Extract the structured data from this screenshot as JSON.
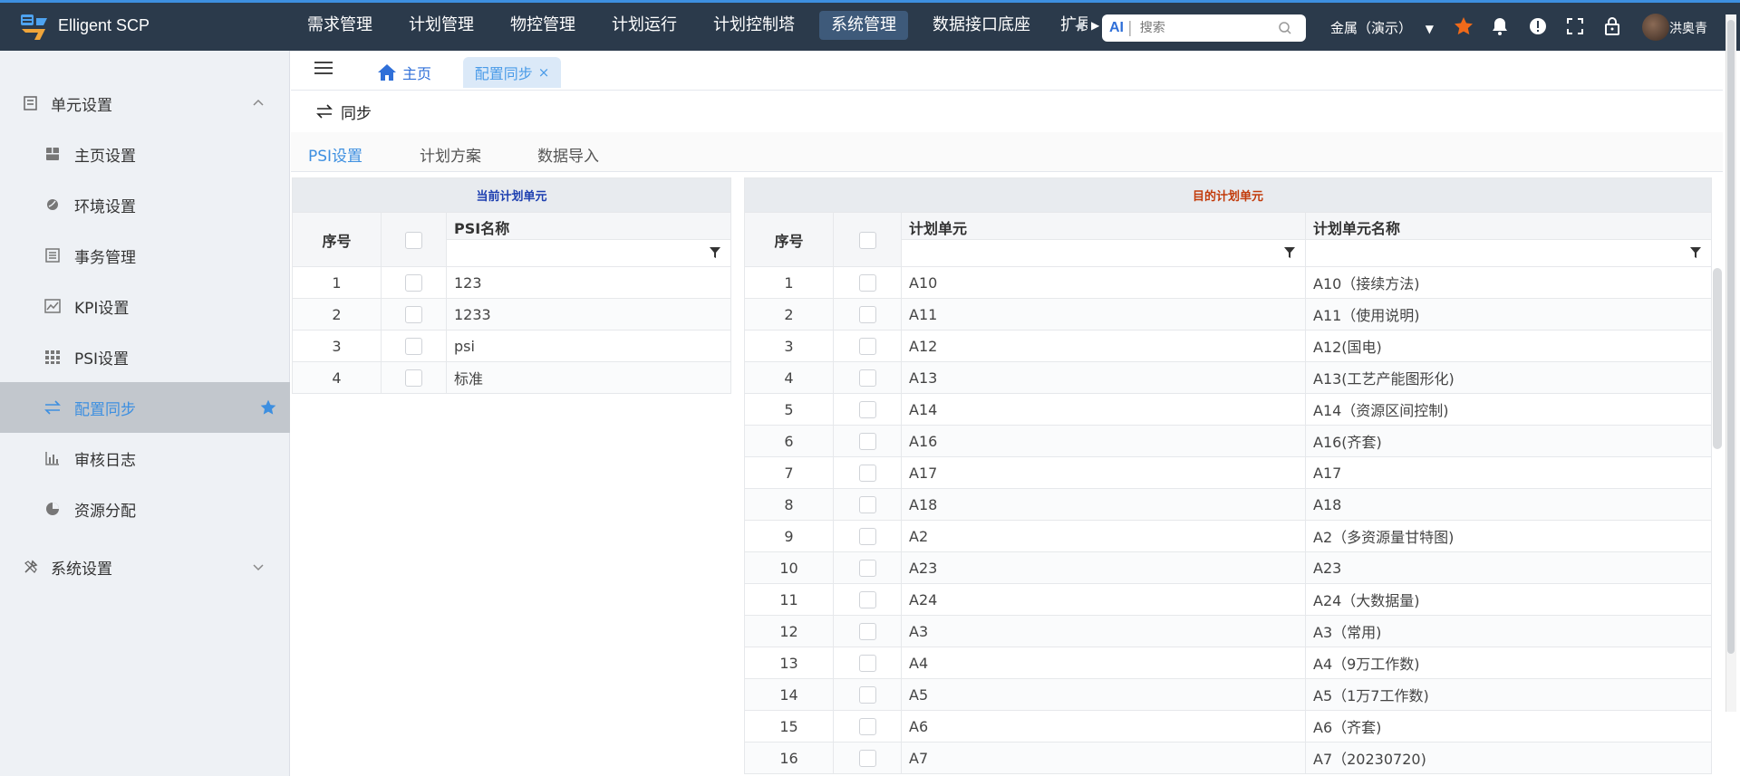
{
  "app": {
    "name": "Elligent SCP"
  },
  "menu": [
    "需求管理",
    "计划管理",
    "物控管理",
    "计划运行",
    "计划控制塔",
    "系统管理",
    "数据接口底座",
    "扩展"
  ],
  "menu_active_index": 5,
  "search": {
    "ai_label": "AI",
    "placeholder": "搜索"
  },
  "tenant": "金属（演示）",
  "user": {
    "name": "洪奥青"
  },
  "sidebar": {
    "group1": "单元设置",
    "items": [
      "主页设置",
      "环境设置",
      "事务管理",
      "KPI设置",
      "PSI设置",
      "配置同步",
      "审核日志",
      "资源分配"
    ],
    "active_index": 5,
    "group2": "系统设置"
  },
  "tabs": {
    "home": "主页",
    "active": "配置同步",
    "close": "×"
  },
  "toolbar": {
    "sync": "同步"
  },
  "subtabs": [
    "PSI设置",
    "计划方案",
    "数据导入"
  ],
  "subtab_active": 0,
  "left_table": {
    "caption": "当前计划单元",
    "columns": {
      "index": "序号",
      "name": "PSI名称"
    },
    "rows": [
      {
        "index": "1",
        "name": "123"
      },
      {
        "index": "2",
        "name": "1233"
      },
      {
        "index": "3",
        "name": "psi"
      },
      {
        "index": "4",
        "name": "标准"
      }
    ]
  },
  "right_table": {
    "caption": "目的计划单元",
    "columns": {
      "index": "序号",
      "unit": "计划单元",
      "unit_name": "计划单元名称"
    },
    "rows": [
      {
        "index": "1",
        "unit": "A10",
        "unit_name": "A10（接续方法)"
      },
      {
        "index": "2",
        "unit": "A11",
        "unit_name": "A11（使用说明)"
      },
      {
        "index": "3",
        "unit": "A12",
        "unit_name": "A12(国电)"
      },
      {
        "index": "4",
        "unit": "A13",
        "unit_name": "A13(工艺产能图形化)"
      },
      {
        "index": "5",
        "unit": "A14",
        "unit_name": "A14（资源区间控制)"
      },
      {
        "index": "6",
        "unit": "A16",
        "unit_name": "A16(齐套)"
      },
      {
        "index": "7",
        "unit": "A17",
        "unit_name": "A17"
      },
      {
        "index": "8",
        "unit": "A18",
        "unit_name": "A18"
      },
      {
        "index": "9",
        "unit": "A2",
        "unit_name": "A2（多资源量甘特图)"
      },
      {
        "index": "10",
        "unit": "A23",
        "unit_name": "A23"
      },
      {
        "index": "11",
        "unit": "A24",
        "unit_name": "A24（大数据量)"
      },
      {
        "index": "12",
        "unit": "A3",
        "unit_name": "A3（常用)"
      },
      {
        "index": "13",
        "unit": "A4",
        "unit_name": "A4（9万工作数)"
      },
      {
        "index": "14",
        "unit": "A5",
        "unit_name": "A5（1万7工作数)"
      },
      {
        "index": "15",
        "unit": "A6",
        "unit_name": "A6（齐套)"
      },
      {
        "index": "16",
        "unit": "A7",
        "unit_name": "A7（20230720)"
      }
    ]
  },
  "colors": {
    "topbar": "#2b3a4b",
    "accent": "#3d8fe0",
    "left_caption": "#1d3fb0",
    "right_caption": "#c23b0b",
    "star": "#f06a1a"
  }
}
